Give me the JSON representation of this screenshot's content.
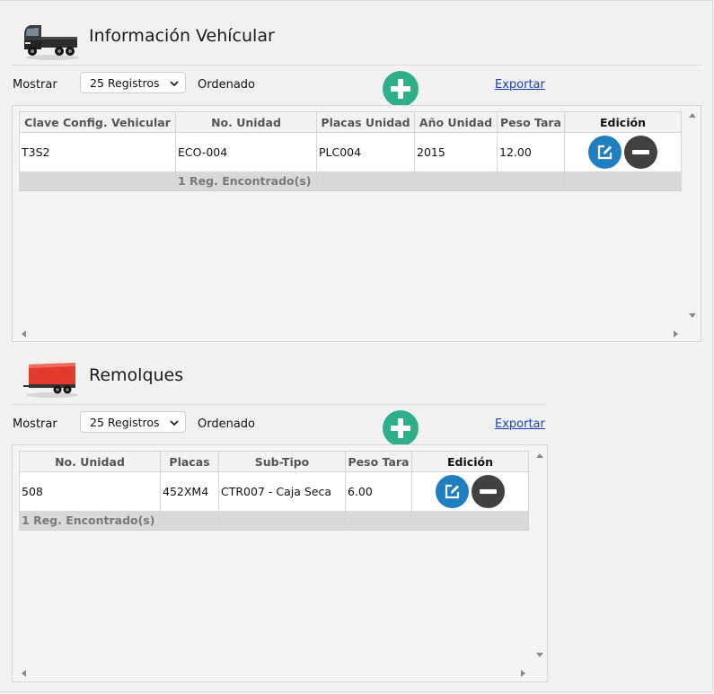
{
  "vehiculos": {
    "title": "Información Vehícular",
    "icon": "truck-icon",
    "mostrar_label": "Mostrar",
    "registros_value": "25 Registros",
    "ordenado_label": "Ordenado",
    "exportar_label": "Exportar",
    "columns": [
      "Clave Config. Vehicular",
      "No. Unidad",
      "Placas Unidad",
      "Año Unidad",
      "Peso Tara",
      "Edición"
    ],
    "rows": [
      {
        "clave": "T3S2",
        "unidad": "ECO-004",
        "placas": "PLC004",
        "anio": "2015",
        "peso": "12.00"
      }
    ],
    "footer": "1 Reg. Encontrado(s)"
  },
  "remolques": {
    "title": "Remolques",
    "icon": "trailer-icon",
    "mostrar_label": "Mostrar",
    "registros_value": "25 Registros",
    "ordenado_label": "Ordenado",
    "exportar_label": "Exportar",
    "columns": [
      "No. Unidad",
      "Placas",
      "Sub-Tipo",
      "Peso Tara",
      "Edición"
    ],
    "rows": [
      {
        "unidad": "508",
        "placas": "452XM4",
        "subtipo": "CTR007 - Caja Seca",
        "peso": "6.00"
      }
    ],
    "footer": "1 Reg. Encontrado(s)"
  },
  "colors": {
    "add": "#2fae8a",
    "edit": "#1f7fc1",
    "delete": "#414141",
    "link": "#1a3fb5",
    "trailer": "#e23b2e"
  }
}
